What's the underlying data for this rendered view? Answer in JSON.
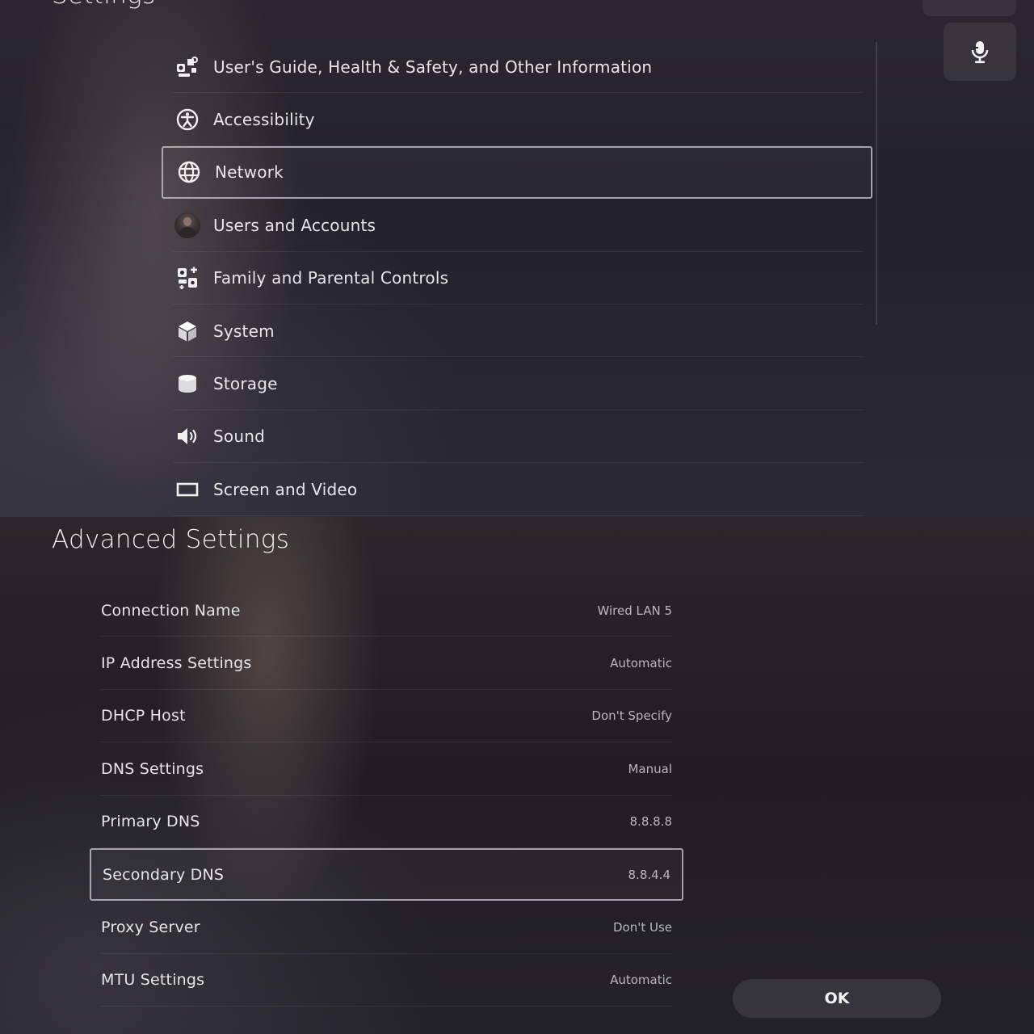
{
  "top": {
    "title": "Settings",
    "mic_icon": "microphone-icon",
    "items": [
      {
        "label": "User's Guide, Health & Safety, and Other Information",
        "icon": "info-guide-icon"
      },
      {
        "label": "Accessibility",
        "icon": "accessibility-icon"
      },
      {
        "label": "Network",
        "icon": "globe-icon",
        "selected": true
      },
      {
        "label": "Users and Accounts",
        "icon": "user-avatar"
      },
      {
        "label": "Family and Parental Controls",
        "icon": "family-controls-icon"
      },
      {
        "label": "System",
        "icon": "cube-icon"
      },
      {
        "label": "Storage",
        "icon": "storage-icon"
      },
      {
        "label": "Sound",
        "icon": "speaker-icon"
      },
      {
        "label": "Screen and Video",
        "icon": "screen-icon"
      }
    ]
  },
  "advanced": {
    "title": "Advanced Settings",
    "rows": [
      {
        "label": "Connection Name",
        "value": "Wired LAN 5"
      },
      {
        "label": "IP Address Settings",
        "value": "Automatic"
      },
      {
        "label": "DHCP Host",
        "value": "Don't Specify"
      },
      {
        "label": "DNS Settings",
        "value": "Manual"
      },
      {
        "label": "Primary DNS",
        "value": "8.8.8.8"
      },
      {
        "label": "Secondary DNS",
        "value": "8.8.4.4",
        "selected": true
      },
      {
        "label": "Proxy Server",
        "value": "Don't Use"
      },
      {
        "label": "MTU Settings",
        "value": "Automatic"
      }
    ],
    "ok_label": "OK"
  },
  "colors": {
    "selection_border": "#cdc8d7",
    "text": "#e6e4e8",
    "secondary_text": "#b9b6bd"
  }
}
